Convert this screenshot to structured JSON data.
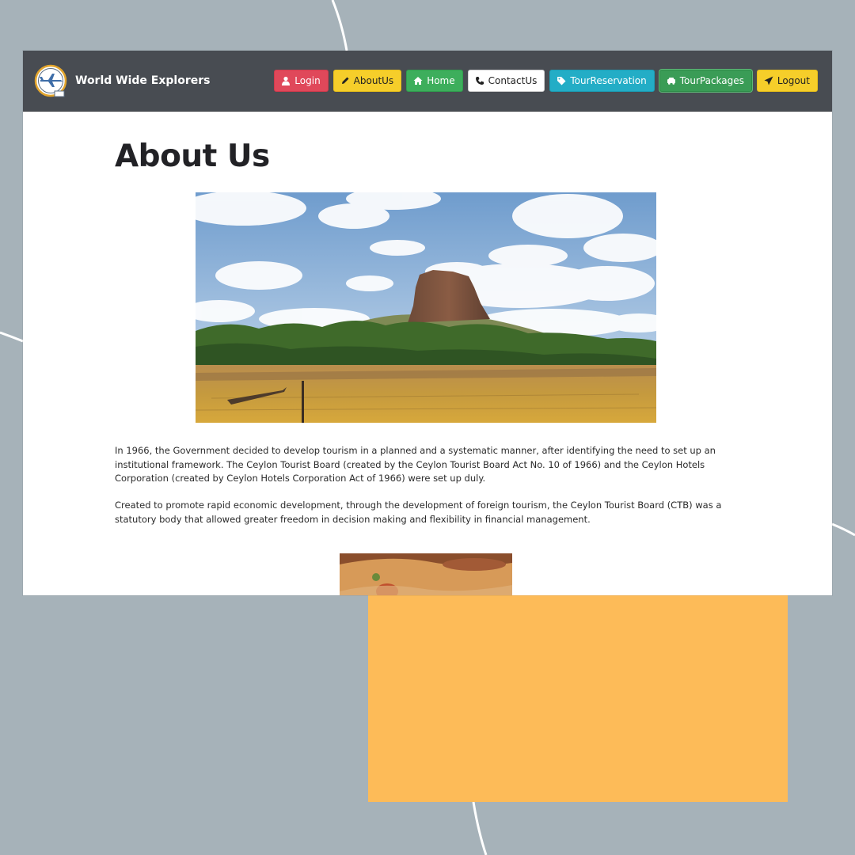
{
  "brand": {
    "name": "World Wide Explorers"
  },
  "nav": {
    "login": "Login",
    "about": "AboutUs",
    "home": "Home",
    "contact": "ContactUs",
    "reservation": "TourReservation",
    "packages": "TourPackages",
    "logout": "Logout"
  },
  "page": {
    "title": "About Us",
    "paragraph1": "In 1966, the Government decided to develop tourism in a planned and a systematic manner, after identifying the need to set up an institutional framework. The Ceylon Tourist Board (created by the Ceylon Tourist Board Act No. 10 of 1966) and the Ceylon Hotels Corporation (created by Ceylon Hotels Corporation Act of 1966) were set up duly.",
    "paragraph2": "Created to promote rapid economic development, through the development of foreign tourism, the Ceylon Tourist Board (CTB) was a statutory body that allowed greater freedom in decision making and flexibility in financial management."
  },
  "colors": {
    "background": "#a6b2b9",
    "navbar": "#484c52",
    "accent_block": "#fdbb58",
    "login": "#e0485a",
    "about": "#f6ce2a",
    "home": "#3dae5c",
    "contact": "#ffffff",
    "reservation": "#23adc6",
    "packages": "#3a9c56",
    "logout": "#f6ce2a"
  },
  "icons": {
    "brand": "airplane-logo-icon",
    "login": "user-icon",
    "about": "pencil-icon",
    "home": "home-icon",
    "contact": "phone-icon",
    "reservation": "tag-icon",
    "packages": "car-icon",
    "logout": "paper-plane-icon"
  }
}
